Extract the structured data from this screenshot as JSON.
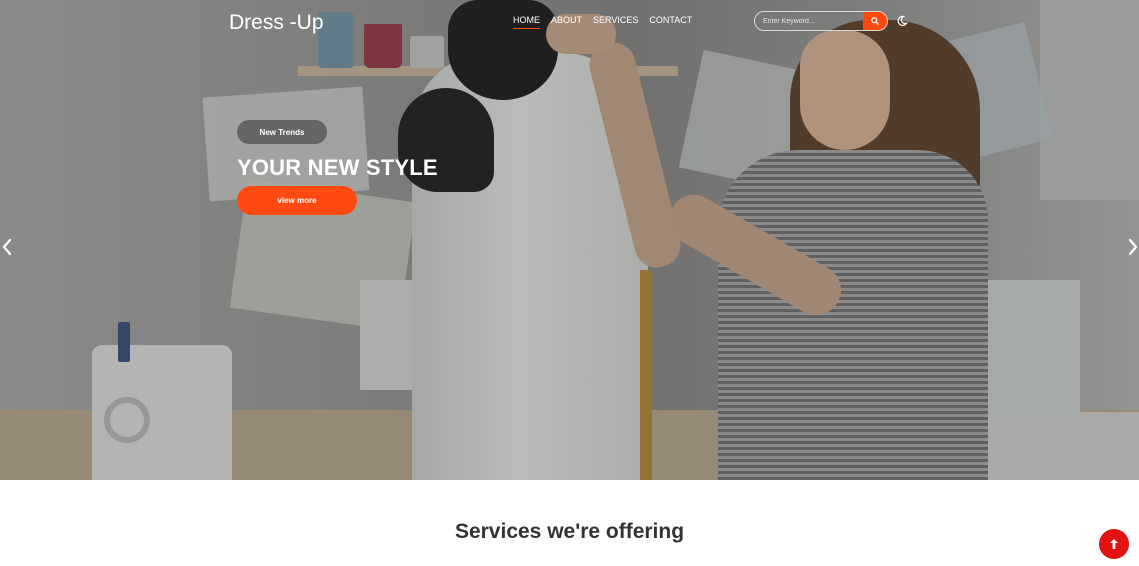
{
  "header": {
    "logo": "Dress -Up",
    "nav": [
      {
        "label": "HOME",
        "active": true
      },
      {
        "label": "ABOUT",
        "active": false
      },
      {
        "label": "SERVICES",
        "active": false
      },
      {
        "label": "CONTACT",
        "active": false
      }
    ],
    "search": {
      "placeholder": "Enter Keyword...",
      "value": ""
    },
    "icons": {
      "search": "search-icon",
      "theme": "moon-icon"
    }
  },
  "hero": {
    "tag": "New Trends",
    "headline": "YOUR NEW STYLE",
    "cta": "view more",
    "icons": {
      "prev": "chevron-left-icon",
      "next": "chevron-right-icon"
    }
  },
  "services": {
    "title": "Services we're offering"
  },
  "back_to_top": {
    "icon": "arrow-up-icon"
  },
  "colors": {
    "accent": "#ff4b12",
    "top_button": "#e3110f",
    "heading": "#333333"
  }
}
